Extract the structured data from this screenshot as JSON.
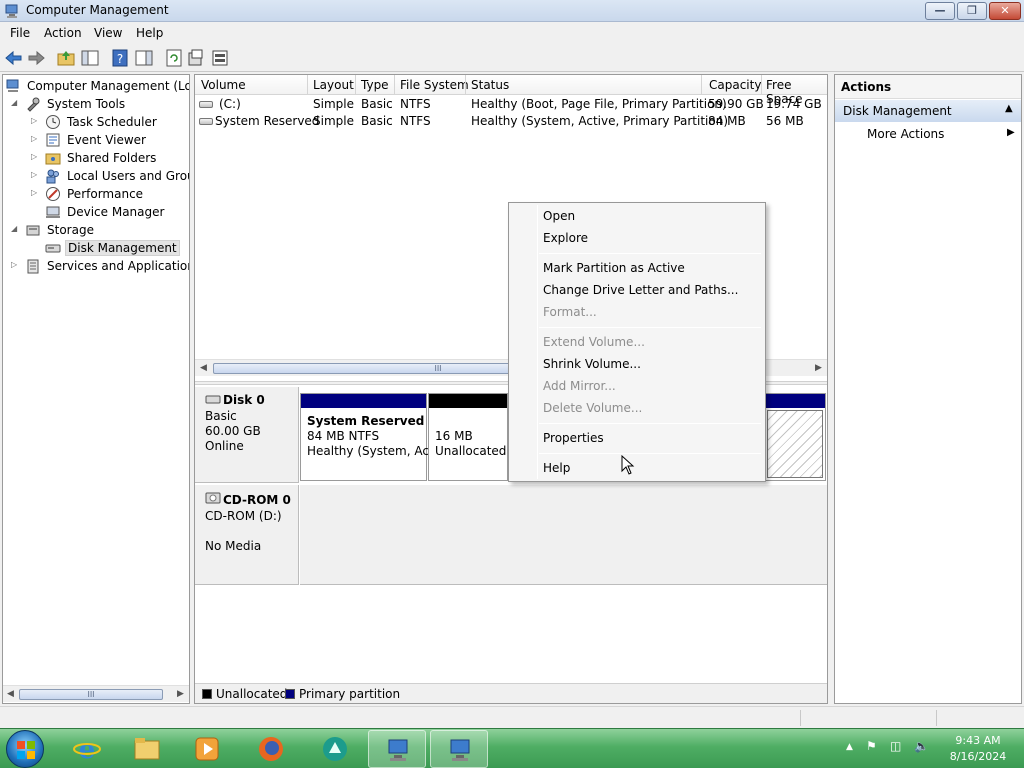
{
  "window": {
    "title": "Computer Management",
    "buttons": [
      "minimize",
      "restore",
      "close"
    ]
  },
  "menubar": [
    "File",
    "Action",
    "View",
    "Help"
  ],
  "tree": {
    "root": "Computer Management (Local",
    "items": [
      {
        "label": "System Tools",
        "icon": "tools-icon"
      },
      {
        "label": "Task Scheduler",
        "icon": "clock-icon"
      },
      {
        "label": "Event Viewer",
        "icon": "event-viewer-icon"
      },
      {
        "label": "Shared Folders",
        "icon": "shared-folder-icon"
      },
      {
        "label": "Local Users and Groups",
        "icon": "users-icon"
      },
      {
        "label": "Performance",
        "icon": "performance-icon"
      },
      {
        "label": "Device Manager",
        "icon": "device-manager-icon"
      },
      {
        "label": "Storage",
        "icon": "storage-icon"
      },
      {
        "label": "Disk Management",
        "icon": "disk-icon"
      },
      {
        "label": "Services and Applications",
        "icon": "services-icon"
      }
    ],
    "scroll_thumb": "III"
  },
  "volumes": {
    "columns": [
      "Volume",
      "Layout",
      "Type",
      "File System",
      "Status",
      "Capacity",
      "Free Space"
    ],
    "rows": [
      [
        "(C:)",
        "Simple",
        "Basic",
        "NTFS",
        "Healthy (Boot, Page File, Primary Partition)",
        "59.90 GB",
        "19.74 GB"
      ],
      [
        "System Reserved",
        "Simple",
        "Basic",
        "NTFS",
        "Healthy (System, Active, Primary Partition)",
        "84 MB",
        "56 MB"
      ]
    ],
    "scroll_thumb": "III"
  },
  "disks": [
    {
      "name": "Disk 0",
      "type": "Basic",
      "size": "60.00 GB",
      "state": "Online"
    },
    {
      "name": "CD-ROM 0",
      "type": "CD-ROM (D:)",
      "size": "",
      "state": "No Media"
    }
  ],
  "partitions": [
    {
      "name": "System Reserved",
      "size": "84 MB NTFS",
      "status": "Healthy (System, Acti"
    },
    {
      "name": "",
      "size": "16 MB",
      "status": "Unallocated"
    }
  ],
  "legend": [
    {
      "label": "Unallocated",
      "color": "#000000"
    },
    {
      "label": "Primary partition",
      "color": "#00007f"
    }
  ],
  "actions": {
    "header": "Actions",
    "group": "Disk Management",
    "more": "More Actions"
  },
  "context_menu": {
    "items": [
      {
        "label": "Open",
        "enabled": true
      },
      {
        "label": "Explore",
        "enabled": true
      },
      {
        "label": "Mark Partition as Active",
        "enabled": true
      },
      {
        "label": "Change Drive Letter and Paths...",
        "enabled": true
      },
      {
        "label": "Format...",
        "enabled": false
      },
      {
        "label": "Extend Volume...",
        "enabled": false
      },
      {
        "label": "Shrink Volume...",
        "enabled": true
      },
      {
        "label": "Add Mirror...",
        "enabled": false
      },
      {
        "label": "Delete Volume...",
        "enabled": false
      },
      {
        "label": "Properties",
        "enabled": true
      },
      {
        "label": "Help",
        "enabled": true
      }
    ]
  },
  "taskbar": {
    "apps": [
      "internet-explorer-icon",
      "file-explorer-icon",
      "media-player-icon",
      "firefox-icon",
      "app-icon",
      "computer-management-icon",
      "computer-management-icon"
    ],
    "time": "9:43 AM",
    "date": "8/16/2024"
  },
  "colors": {
    "primary_partition": "#00007f",
    "unallocated": "#000000",
    "taskbar": "#4fae64",
    "selection": "#c9d9ee"
  }
}
